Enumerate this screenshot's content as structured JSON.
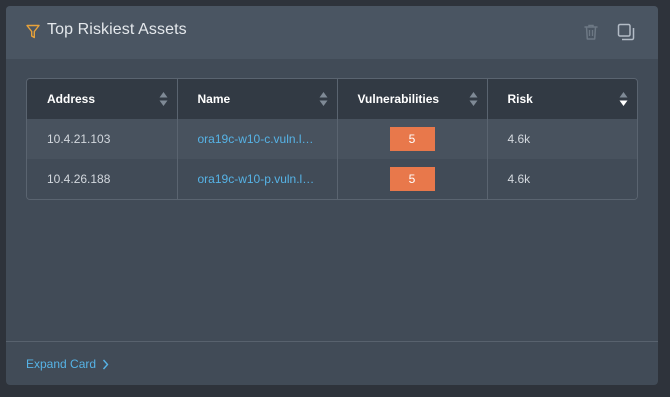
{
  "card": {
    "title": "Top Riskiest Assets",
    "icons": {
      "filter": "filter-icon",
      "delete": "trash-icon",
      "duplicate": "copy-icon"
    }
  },
  "table": {
    "columns": [
      {
        "label": "Address",
        "sort": "sortable"
      },
      {
        "label": "Name",
        "sort": "sortable"
      },
      {
        "label": "Vulnerabilities",
        "sort": "sortable"
      },
      {
        "label": "Risk",
        "sort": "descending"
      }
    ],
    "rows": [
      {
        "address": "10.4.21.103",
        "name": "ora19c-w10-c.vuln.la…",
        "vulnerabilities": "5",
        "risk": "4.6k"
      },
      {
        "address": "10.4.26.188",
        "name": "ora19c-w10-p.vuln.la…",
        "vulnerabilities": "5",
        "risk": "4.6k"
      }
    ]
  },
  "footer": {
    "expand_label": "Expand Card"
  },
  "colors": {
    "accent_link": "#56b3e6",
    "vuln_badge": "#e8784b",
    "filter_icon": "#e8a23a"
  }
}
